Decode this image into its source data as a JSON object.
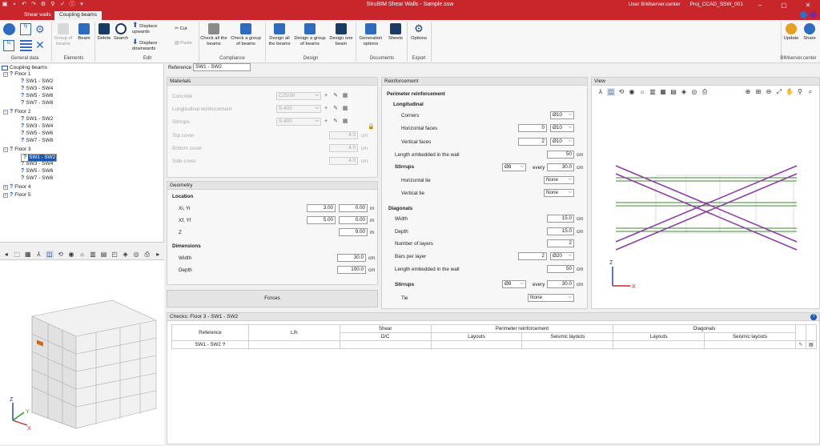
{
  "app": {
    "title": "StruBIM Shear Walls - Sample.ssw",
    "user": "User BIMserver.center",
    "project": "Proj_CCAD_SSW_001"
  },
  "tabs": [
    "Shear walls",
    "Coupling beams"
  ],
  "ribbon": {
    "general": {
      "label": "General data"
    },
    "elements": {
      "label": "Elements",
      "group_of_beams": "Group of beams",
      "beam": "Beam"
    },
    "edit": {
      "label": "Edit",
      "delete": "Delete",
      "search": "Search",
      "displace_up": "Displace upwards",
      "displace_down": "Displace downwards",
      "cut": "Cut",
      "paste": "Paste"
    },
    "compliance": {
      "label": "Compliance",
      "check_all": "Check all the beams",
      "check_group": "Check a group of beams"
    },
    "design": {
      "label": "Design",
      "design_all": "Design all the beams",
      "design_group": "Design a group of beams",
      "design_one": "Design one beam"
    },
    "documents": {
      "label": "Documents",
      "generation": "Generation options",
      "sheets": "Sheets"
    },
    "export": {
      "label": "Export",
      "options": "Options"
    },
    "bimserver": {
      "label": "BIMserver.center",
      "update": "Update",
      "share": "Share"
    }
  },
  "tree": {
    "root": "Coupling beams",
    "floors": [
      {
        "name": "Floor 1",
        "beams": [
          "SW1 - SW2",
          "SW3 - SW4",
          "SW5 - SW6",
          "SW7 - SW8"
        ]
      },
      {
        "name": "Floor 2",
        "beams": [
          "SW1 - SW2",
          "SW3 - SW4",
          "SW5 - SW6",
          "SW7 - SW8"
        ]
      },
      {
        "name": "Floor 3",
        "beams": [
          "SW1 - SW2",
          "SW3 - SW4",
          "SW5 - SW6",
          "SW7 - SW8"
        ]
      },
      {
        "name": "Floor 4",
        "beams": []
      },
      {
        "name": "Floor 5",
        "beams": []
      }
    ]
  },
  "reference": {
    "label": "Reference",
    "value": "SW1 - SW2"
  },
  "materials": {
    "title": "Materials",
    "concrete": {
      "label": "Concrete",
      "value": "C25/30"
    },
    "long": {
      "label": "Longitudinal reinforcement",
      "value": "S-400"
    },
    "stirrups": {
      "label": "Stirrups",
      "value": "S-400"
    },
    "top": {
      "label": "Top cover",
      "value": "4.0",
      "unit": "cm"
    },
    "bottom": {
      "label": "Bottom cover",
      "value": "4.0",
      "unit": "cm"
    },
    "side": {
      "label": "Side cover",
      "value": "4.0",
      "unit": "cm"
    }
  },
  "geometry": {
    "title": "Geometry",
    "location": "Location",
    "xi": {
      "label": "Xi, Yi",
      "x": "3.00",
      "y": "0.00",
      "unit": "m"
    },
    "xf": {
      "label": "Xf, Yf",
      "x": "5.00",
      "y": "0.00",
      "unit": "m"
    },
    "z": {
      "label": "Z",
      "value": "9.00",
      "unit": "m"
    },
    "dimensions": "Dimensions",
    "width": {
      "label": "Width",
      "value": "30.0",
      "unit": "cm"
    },
    "depth": {
      "label": "Depth",
      "value": "100.0",
      "unit": "cm"
    }
  },
  "forces": "Forces",
  "reinforcement": {
    "title": "Reinforcement",
    "perimeter": "Perimeter reinforcement",
    "longitudinal": "Longitudinal",
    "corners": {
      "label": "Corners",
      "value": "Ø10"
    },
    "horizontal": {
      "label": "Horizontal faces",
      "n": "0",
      "value": "Ø10"
    },
    "vertical": {
      "label": "Vertical faces",
      "n": "2",
      "value": "Ø10"
    },
    "embedded": {
      "label": "Length embedded in the wall",
      "value": "50",
      "unit": "cm"
    },
    "stirrups": {
      "label": "Stirrups",
      "dia": "Ø8",
      "every": "every",
      "value": "30.0",
      "unit": "cm"
    },
    "htie": {
      "label": "Horizontal tie",
      "value": "None"
    },
    "vtie": {
      "label": "Vertical tie",
      "value": "None"
    },
    "diagonals": "Diagonals",
    "dwidth": {
      "label": "Width",
      "value": "15.0",
      "unit": "cm"
    },
    "ddepth": {
      "label": "Depth",
      "value": "15.0",
      "unit": "cm"
    },
    "layers": {
      "label": "Number of layers",
      "value": "2"
    },
    "bars": {
      "label": "Bars per layer",
      "n": "2",
      "value": "Ø20"
    },
    "dembedded": {
      "label": "Length embedded in the wall",
      "value": "50",
      "unit": "cm"
    },
    "dstirrups": {
      "label": "Stirrups",
      "dia": "Ø8",
      "every": "every",
      "value": "30.0",
      "unit": "cm"
    },
    "tie": {
      "label": "Tie",
      "value": "None"
    }
  },
  "view": {
    "title": "View"
  },
  "checks": {
    "title": "Checks: Floor 3 - SW1 - SW2",
    "headers": {
      "reference": "Reference",
      "lh": "L/h",
      "shear": "Shear",
      "dc": "D/C",
      "perimeter": "Perimeter reinforcement",
      "diagonals": "Diagonals",
      "layouts": "Layouts",
      "seismic": "Seismic layouts"
    },
    "row": {
      "reference": "SW1 - SW2"
    }
  },
  "colors": {
    "brand": "#c8262b",
    "selection": "#1a56b0",
    "diagonal": "#8e3fa6",
    "longbar": "#3a8a2a"
  }
}
